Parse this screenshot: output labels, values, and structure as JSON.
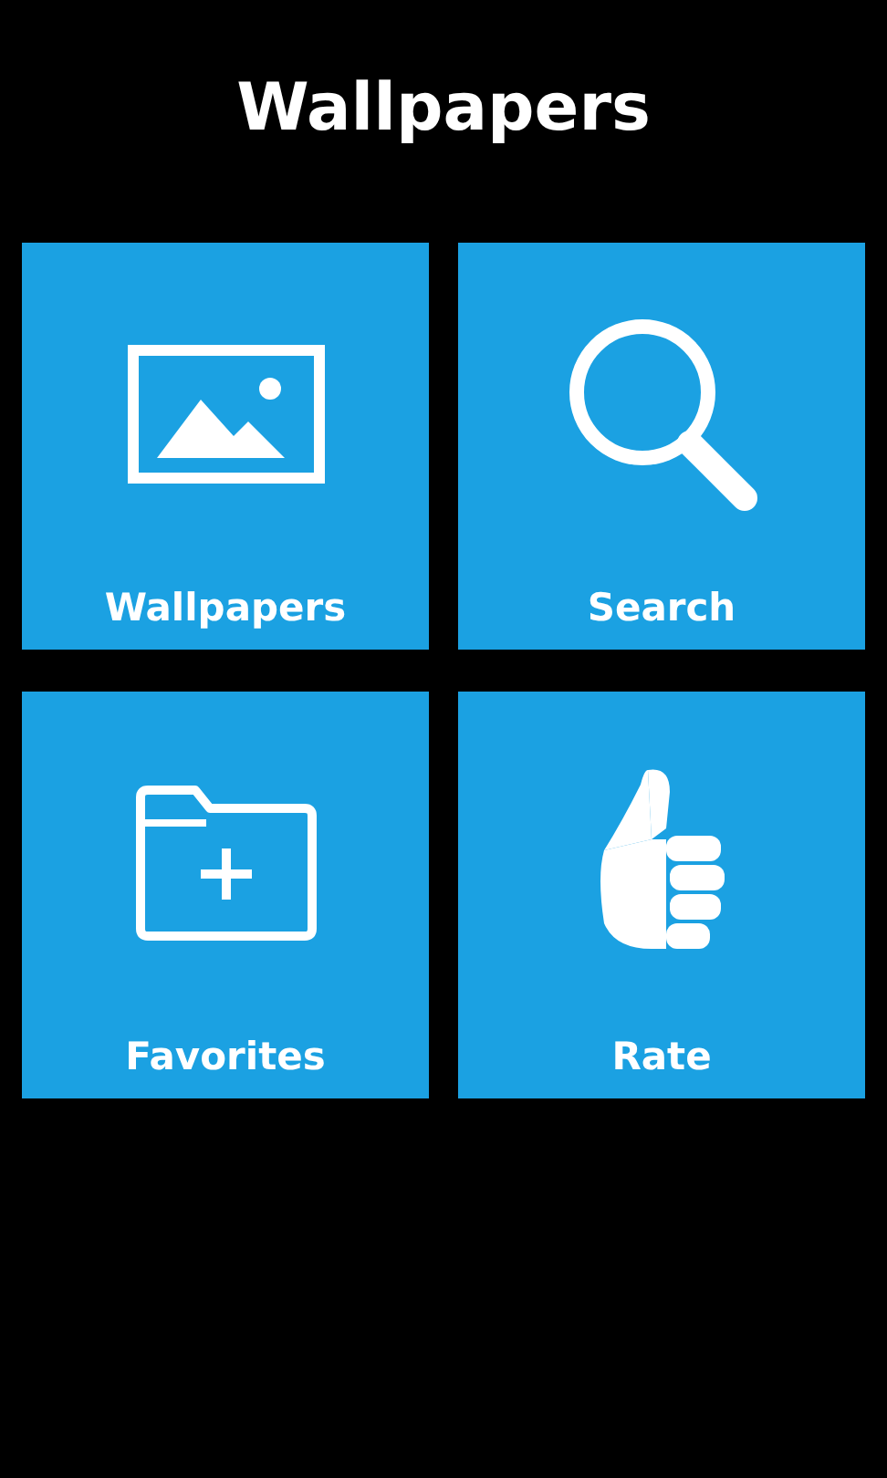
{
  "title": "Wallpapers",
  "tiles": [
    {
      "kind": "image",
      "label": "Wallpapers"
    },
    {
      "kind": "search",
      "label": "Search"
    },
    {
      "kind": "folder",
      "label": "Favorites"
    },
    {
      "kind": "thumb",
      "label": "Rate"
    }
  ]
}
